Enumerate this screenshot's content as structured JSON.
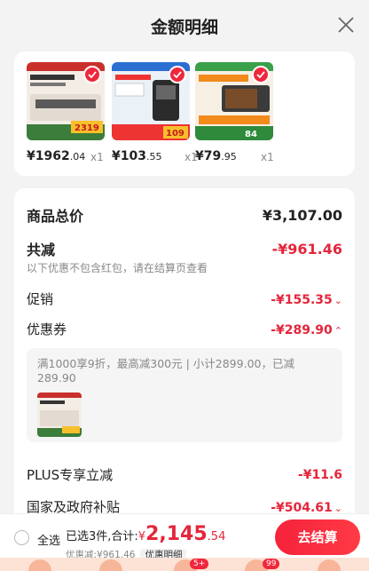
{
  "header": {
    "title": "金额明细"
  },
  "products": [
    {
      "price_int": "¥1962",
      "price_dec": ".04",
      "qty": "x1",
      "thumb_text": "2319"
    },
    {
      "price_int": "¥103",
      "price_dec": ".55",
      "qty": "x1",
      "thumb_text": "109"
    },
    {
      "price_int": "¥79",
      "price_dec": ".95",
      "qty": "x1",
      "thumb_text": "84"
    }
  ],
  "detail": {
    "total_label": "商品总价",
    "total_value": "¥3,107.00",
    "reduce_label": "共减",
    "reduce_value": "-¥961.46",
    "reduce_note": "以下优惠不包含红包，请在结算页查看",
    "promo_label": "促销",
    "promo_value": "-¥155.35",
    "coupon_label": "优惠券",
    "coupon_value": "-¥289.90",
    "coupon_desc": "满1000享9折，最高减300元 | 小计2899.00，已减289.90",
    "plus_label": "PLUS专享立减",
    "plus_value": "-¥11.6",
    "subsidy_label": "国家及政府补贴",
    "subsidy_value": "-¥504.61"
  },
  "bottom": {
    "select_all": "全选",
    "summary_prefix": "已选3件,合计:",
    "yen": "¥",
    "amount": "2,145",
    "amount_dec": ".54",
    "discount_text": "优惠减:¥961.46",
    "detail_tag": "优惠明细",
    "checkout": "去结算"
  },
  "tabbar": {
    "badge1": "5+",
    "badge2": "99"
  },
  "colors": {
    "accent": "#e4263b",
    "checkout_bg": "#f5223b"
  }
}
